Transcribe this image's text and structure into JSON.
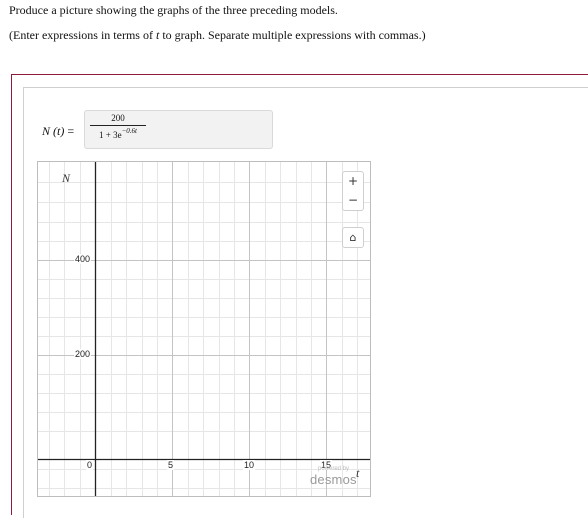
{
  "question": {
    "line1": "Produce a picture showing the graphs of the three preceding models.",
    "line2_pre": "(Enter expressions in terms of ",
    "line2_var": "t",
    "line2_post": " to graph. Separate multiple expressions with commas.)"
  },
  "expression": {
    "lhs_name": "N",
    "lhs_arg": "(t)",
    "eq": "=",
    "numerator": "200",
    "denominator_base": "1 + 3e",
    "denominator_exp": "−0.6t"
  },
  "graph": {
    "y_axis_label": "N",
    "x_axis_label": "t",
    "x_ticks": [
      "0",
      "5",
      "10",
      "15"
    ],
    "y_ticks": [
      "400",
      "200"
    ],
    "zoom_in_label": "+",
    "zoom_out_label": "−",
    "home_label": "⌂",
    "powered_by": "powered by",
    "brand": "desmos"
  }
}
